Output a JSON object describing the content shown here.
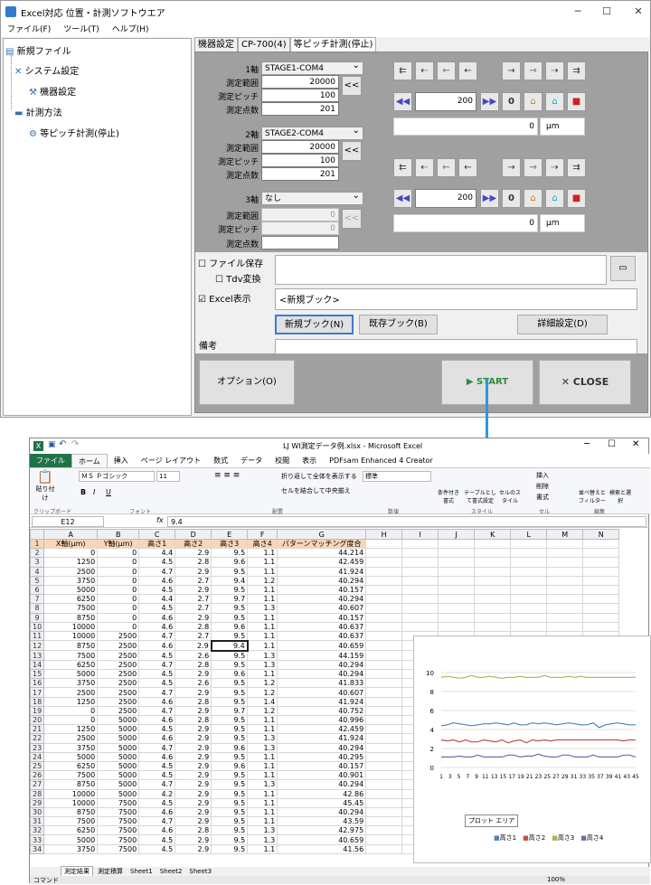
{
  "app": {
    "title": "Excel対応 位置・計測ソフトウエア",
    "menu": [
      "ファイル(F)",
      "ツール(T)",
      "ヘルプ(H)"
    ],
    "tree": {
      "root": "新規ファイル",
      "system": "システム設定",
      "device": "機器設定",
      "method": "計測方法",
      "pitch": "等ピッチ計測(停止)"
    },
    "tabs": [
      "機器設定",
      "CP-700(4)",
      "等ピッチ計測(停止)"
    ],
    "axes": [
      {
        "label": "1軸",
        "stage": "STAGE1-COM4",
        "range_label": "測定範囲",
        "range": "20000",
        "pitch_label": "測定ピッチ",
        "pitch": "100",
        "points_label": "測定点数",
        "points": "201"
      },
      {
        "label": "2軸",
        "stage": "STAGE2-COM4",
        "range_label": "測定範囲",
        "range": "20000",
        "pitch_label": "測定ピッチ",
        "pitch": "100",
        "points_label": "測定点数",
        "points": "201"
      },
      {
        "label": "3軸",
        "stage": "なし",
        "range_label": "測定範囲",
        "range": "0",
        "pitch_label": "測定ピッチ",
        "pitch": "0",
        "points_label": "測定点数",
        "points": ""
      }
    ],
    "collapse": "<<",
    "ctrl": [
      {
        "value": "200",
        "pos": "0",
        "unit": "μm"
      },
      {
        "value": "200",
        "pos": "0",
        "unit": "μm"
      }
    ],
    "zero_label": "0",
    "file_save": "ファイル保存",
    "tdv": "Tdv変換",
    "excel_show": "Excel表示",
    "book": "<新規ブック>",
    "btn_new": "新規ブック(N)",
    "btn_exist": "既存ブック(B)",
    "btn_detail": "詳細設定(D)",
    "note": "備考",
    "btn_option": "オプション(O)",
    "btn_start": "START",
    "btn_close": "CLOSE"
  },
  "excel": {
    "title": "LJ WI測定データ例.xlsx - Microsoft Excel",
    "tabs": [
      "ファイル",
      "ホーム",
      "挿入",
      "ページ レイアウト",
      "数式",
      "データ",
      "校閲",
      "表示",
      "PDFsam Enhanced 4 Creator"
    ],
    "font": "ＭＳ Ｐゴシック",
    "size": "11",
    "numfmt": "標準",
    "wrap": "折り返して全体を表示する",
    "merge": "セルを結合して中央揃え",
    "groups": [
      "クリップボード",
      "フォント",
      "配置",
      "数値",
      "スタイル",
      "セル",
      "編集"
    ],
    "paste": "貼り付け",
    "cond": "条件付き書式",
    "tablefmt": "テーブルとして書式設定",
    "cellstyle": "セルのスタイル",
    "insert": "挿入",
    "delete": "削除",
    "format": "書式",
    "sort": "並べ替えとフィルター",
    "find": "検索と選択",
    "cellref": "E12",
    "fx": "fx",
    "formula": "9.4",
    "cols": [
      "A",
      "B",
      "C",
      "D",
      "E",
      "F",
      "G",
      "H",
      "I",
      "J",
      "K",
      "L",
      "M",
      "N"
    ],
    "headers": [
      "X軸(μm)",
      "Y軸(μm)",
      "高さ1",
      "高さ2",
      "高さ3",
      "高さ4",
      "パターンマッチング度合"
    ],
    "rows": [
      [
        "0",
        "0",
        "4.4",
        "2.9",
        "9.5",
        "1.1",
        "44.214"
      ],
      [
        "1250",
        "0",
        "4.5",
        "2.8",
        "9.6",
        "1.1",
        "42.459"
      ],
      [
        "2500",
        "0",
        "4.7",
        "2.9",
        "9.5",
        "1.1",
        "41.924"
      ],
      [
        "3750",
        "0",
        "4.6",
        "2.7",
        "9.4",
        "1.2",
        "40.294"
      ],
      [
        "5000",
        "0",
        "4.5",
        "2.9",
        "9.5",
        "1.1",
        "40.157"
      ],
      [
        "6250",
        "0",
        "4.4",
        "2.7",
        "9.7",
        "1.1",
        "40.294"
      ],
      [
        "7500",
        "0",
        "4.5",
        "2.7",
        "9.5",
        "1.3",
        "40.607"
      ],
      [
        "8750",
        "0",
        "4.6",
        "2.9",
        "9.5",
        "1.1",
        "40.157"
      ],
      [
        "10000",
        "0",
        "4.6",
        "2.8",
        "9.6",
        "1.1",
        "40.637"
      ],
      [
        "10000",
        "2500",
        "4.7",
        "2.7",
        "9.5",
        "1.1",
        "40.637"
      ],
      [
        "8750",
        "2500",
        "4.6",
        "2.9",
        "9.4",
        "1.1",
        "40.659"
      ],
      [
        "7500",
        "2500",
        "4.5",
        "2.6",
        "9.5",
        "1.3",
        "44.159"
      ],
      [
        "6250",
        "2500",
        "4.7",
        "2.8",
        "9.5",
        "1.3",
        "40.294"
      ],
      [
        "5000",
        "2500",
        "4.5",
        "2.9",
        "9.6",
        "1.1",
        "40.294"
      ],
      [
        "3750",
        "2500",
        "4.5",
        "2.6",
        "9.5",
        "1.2",
        "41.833"
      ],
      [
        "2500",
        "2500",
        "4.7",
        "2.9",
        "9.5",
        "1.2",
        "40.607"
      ],
      [
        "1250",
        "2500",
        "4.6",
        "2.8",
        "9.5",
        "1.4",
        "41.924"
      ],
      [
        "0",
        "2500",
        "4.7",
        "2.9",
        "9.7",
        "1.2",
        "40.752"
      ],
      [
        "0",
        "5000",
        "4.6",
        "2.8",
        "9.5",
        "1.1",
        "40.996"
      ],
      [
        "1250",
        "5000",
        "4.5",
        "2.9",
        "9.5",
        "1.1",
        "42.459"
      ],
      [
        "2500",
        "5000",
        "4.6",
        "2.9",
        "9.5",
        "1.3",
        "41.924"
      ],
      [
        "3750",
        "5000",
        "4.7",
        "2.9",
        "9.6",
        "1.3",
        "40.294"
      ],
      [
        "5000",
        "5000",
        "4.6",
        "2.9",
        "9.5",
        "1.1",
        "40.295"
      ],
      [
        "6250",
        "5000",
        "4.5",
        "2.9",
        "9.6",
        "1.1",
        "40.157"
      ],
      [
        "7500",
        "5000",
        "4.5",
        "2.9",
        "9.5",
        "1.1",
        "40.901"
      ],
      [
        "8750",
        "5000",
        "4.7",
        "2.9",
        "9.5",
        "1.3",
        "40.294"
      ],
      [
        "10000",
        "5000",
        "4.2",
        "2.9",
        "9.5",
        "1.1",
        "42.86"
      ],
      [
        "10000",
        "7500",
        "4.5",
        "2.9",
        "9.5",
        "1.1",
        "45.45"
      ],
      [
        "8750",
        "7500",
        "4.6",
        "2.9",
        "9.5",
        "1.1",
        "40.294"
      ],
      [
        "7500",
        "7500",
        "4.7",
        "2.9",
        "9.5",
        "1.1",
        "43.59"
      ],
      [
        "6250",
        "7500",
        "4.6",
        "2.8",
        "9.5",
        "1.3",
        "42.975"
      ],
      [
        "5000",
        "7500",
        "4.5",
        "2.9",
        "9.5",
        "1.3",
        "40.659"
      ],
      [
        "3750",
        "7500",
        "4.5",
        "2.9",
        "9.5",
        "1.1",
        "41.56"
      ]
    ],
    "sheets": [
      "測定結果",
      "測定積算",
      "Sheet1",
      "Sheet2",
      "Sheet3"
    ],
    "status": "コマンド",
    "zoom": "100%",
    "chart": {
      "tooltip": "プロット エリア",
      "legend": [
        "高さ1",
        "高さ2",
        "高さ3",
        "高さ4"
      ]
    }
  },
  "chart_data": {
    "type": "line",
    "title": "",
    "ylim": [
      0,
      10
    ],
    "yticks": [
      "0",
      "2",
      "4",
      "6",
      "8",
      "10"
    ],
    "x": [
      "1",
      "3",
      "5",
      "7",
      "9",
      "11",
      "13",
      "15",
      "17",
      "19",
      "21",
      "23",
      "25",
      "27",
      "29",
      "31",
      "33",
      "35",
      "37",
      "39",
      "41",
      "43",
      "45"
    ],
    "series": [
      {
        "name": "高さ1",
        "color": "#4f81bd"
      },
      {
        "name": "高さ2",
        "color": "#c0504d"
      },
      {
        "name": "高さ3",
        "color": "#9bbb59"
      },
      {
        "name": "高さ4",
        "color": "#8064a2"
      }
    ]
  },
  "colors": {
    "accent": "#2e75b6",
    "excel_green": "#217346",
    "start_green": "#2e8b3e",
    "arrow": "#2f96e0"
  }
}
